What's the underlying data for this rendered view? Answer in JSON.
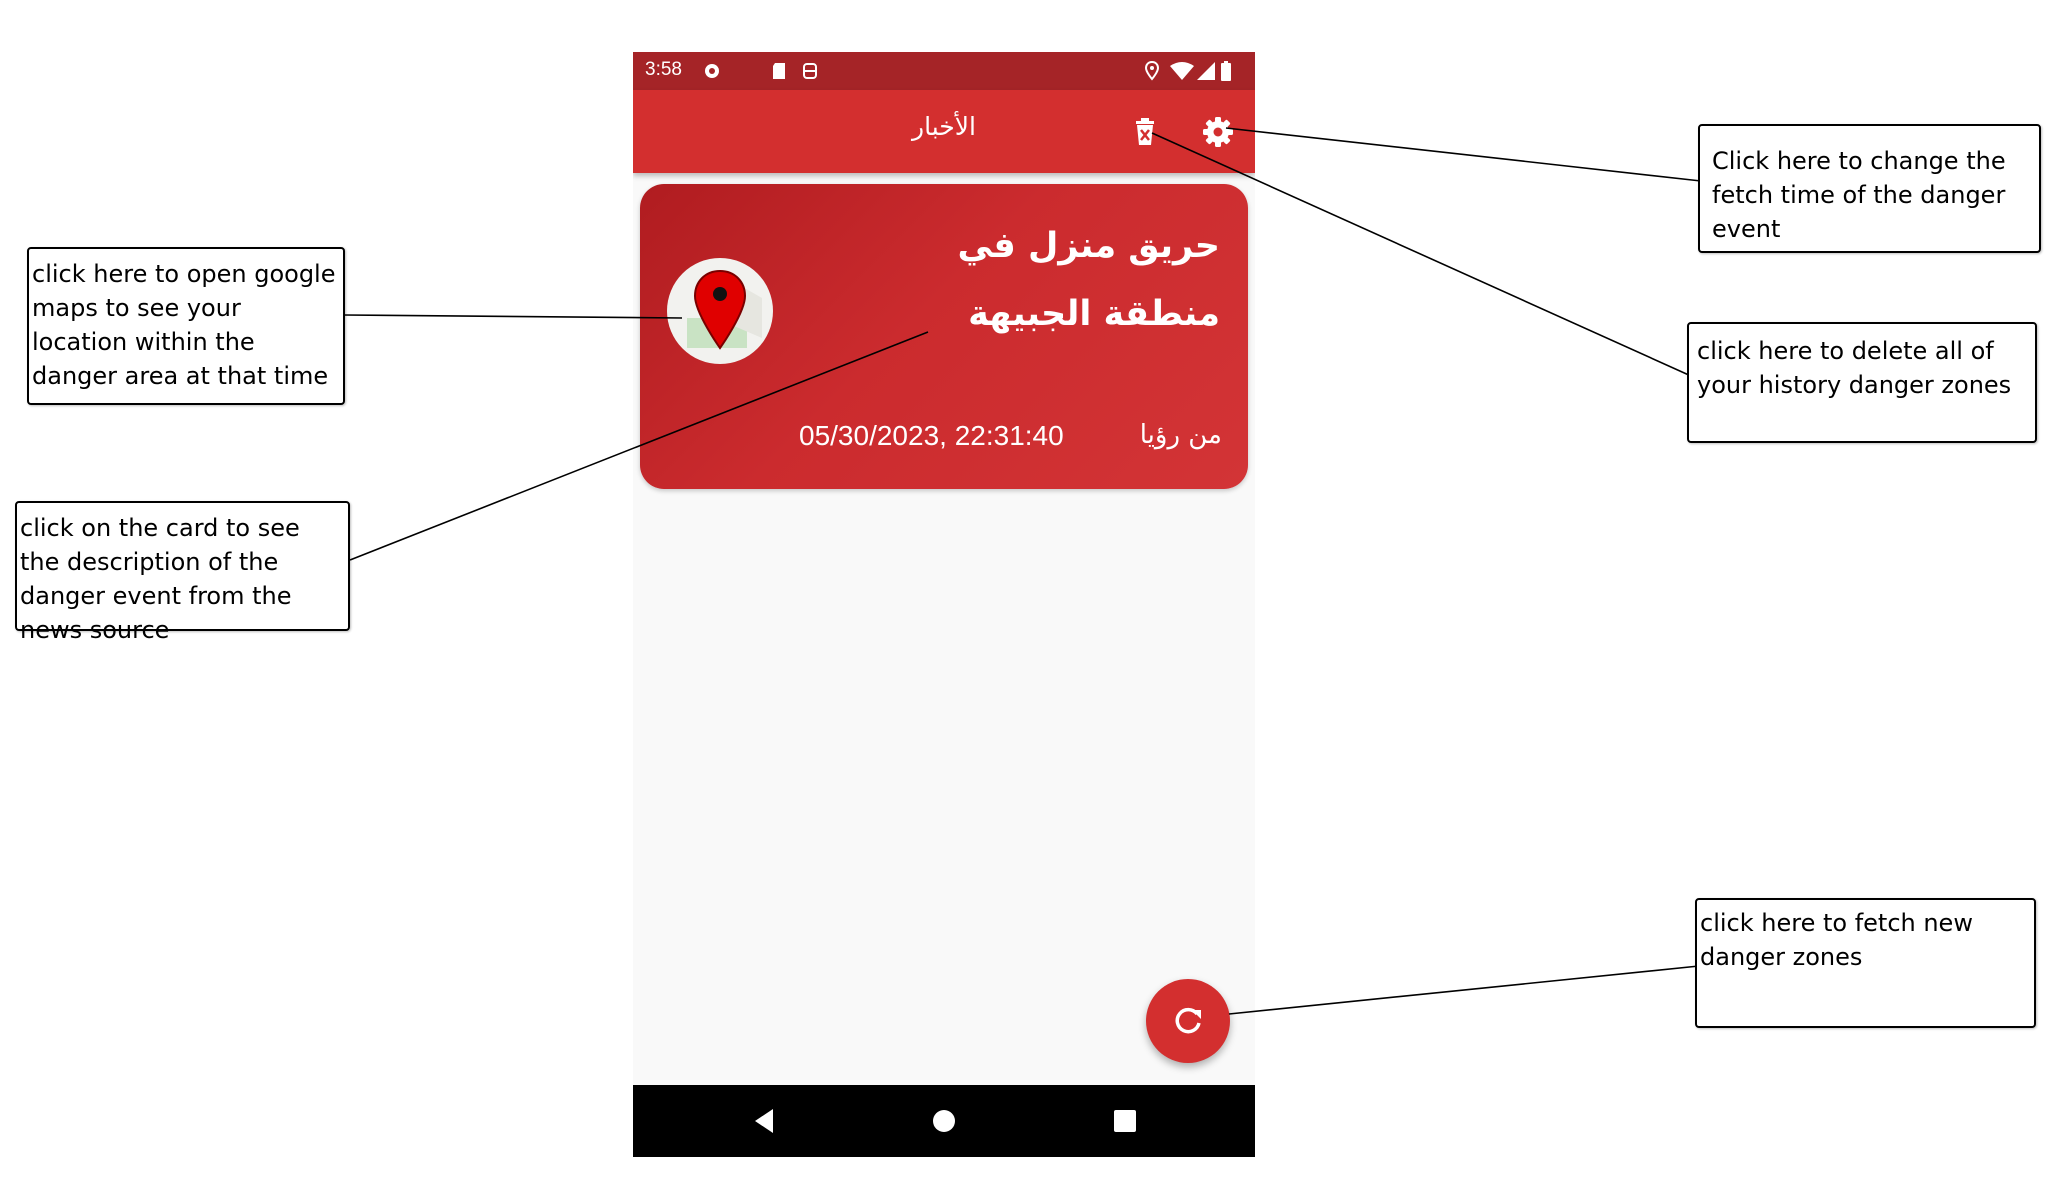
{
  "status_bar": {
    "time": "3:58",
    "icons": [
      "location-icon",
      "wifi-icon",
      "signal-icon",
      "battery-icon",
      "sd-card-icon",
      "notification-icon"
    ]
  },
  "app_bar": {
    "title": "الأخبار",
    "icons": [
      "delete-history-icon",
      "settings-icon"
    ]
  },
  "news_card": {
    "title": "حريق منزل في منطقة الجبيهة",
    "source": "من رؤيا",
    "datetime": "05/30/2023, 22:31:40",
    "map_icon": "map-pin-icon"
  },
  "fab": {
    "icon": "refresh-icon"
  },
  "nav_bar": {
    "icons": [
      "back-icon",
      "home-icon",
      "recents-icon"
    ]
  },
  "callouts": {
    "settings": "Click here to change the fetch time of the danger event",
    "delete": "click here to delete all of your history danger zones",
    "maps": "click here to open google maps to see your location within the danger area at that time",
    "card": "click on the card to see the description of the danger event from the news source",
    "refresh": "click here to fetch new danger zones"
  },
  "colors": {
    "status_bar": "#a52427",
    "app_bar": "#d32f2f",
    "card": "#c62828",
    "fab": "#d32f2f",
    "background": "#f9f9f9"
  }
}
